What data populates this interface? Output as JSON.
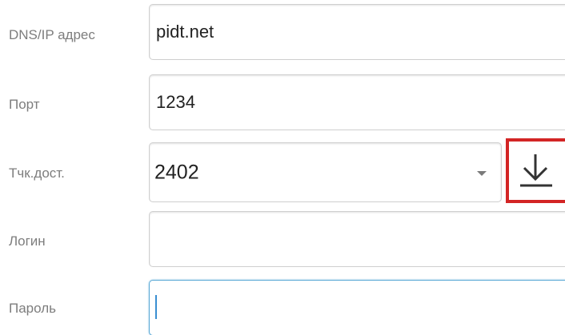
{
  "form": {
    "dns": {
      "label": "DNS/IP адрес",
      "value": "pidt.net"
    },
    "port": {
      "label": "Порт",
      "value": "1234"
    },
    "access_point": {
      "label": "Тчк.дост.",
      "selected": "2402"
    },
    "login": {
      "label": "Логин",
      "value": ""
    },
    "password": {
      "label": "Пароль",
      "value": ""
    }
  },
  "icons": {
    "download": "download-icon",
    "dropdown": "caret-down-icon"
  },
  "colors": {
    "label": "#7d7d7d",
    "highlight_border": "#d32525",
    "focus_border": "#5aa9d6"
  }
}
